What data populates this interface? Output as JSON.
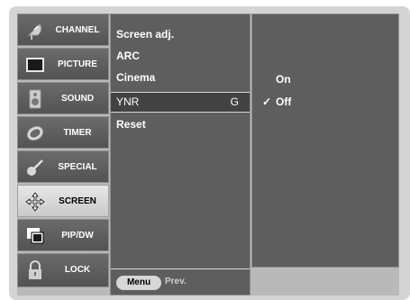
{
  "categories": [
    {
      "label": "CHANNEL",
      "icon": "satellite-dish-icon"
    },
    {
      "label": "PICTURE",
      "icon": "tv-screen-icon"
    },
    {
      "label": "SOUND",
      "icon": "speaker-icon"
    },
    {
      "label": "TIMER",
      "icon": "clock-icon"
    },
    {
      "label": "SPECIAL",
      "icon": "guitar-icon"
    },
    {
      "label": "SCREEN",
      "icon": "arrows-cross-icon",
      "active": true
    },
    {
      "label": "PIP/DW",
      "icon": "pip-windows-icon"
    },
    {
      "label": "LOCK",
      "icon": "padlock-icon"
    }
  ],
  "submenu": {
    "items": [
      {
        "label": "Screen adj."
      },
      {
        "label": "ARC"
      },
      {
        "label": "Cinema"
      },
      {
        "label": "YNR",
        "active": true,
        "suffix": "G"
      },
      {
        "label": "Reset"
      }
    ],
    "footer": {
      "menu_label": "Menu",
      "prev_label": "Prev."
    }
  },
  "options": {
    "items": [
      {
        "label": "On",
        "selected": false
      },
      {
        "label": "Off",
        "selected": true
      }
    ],
    "check_mark": "✓"
  },
  "colors": {
    "panel": "#5e5e5e",
    "active_category": "#d7d7d7",
    "highlight_text": "#ffffff"
  }
}
